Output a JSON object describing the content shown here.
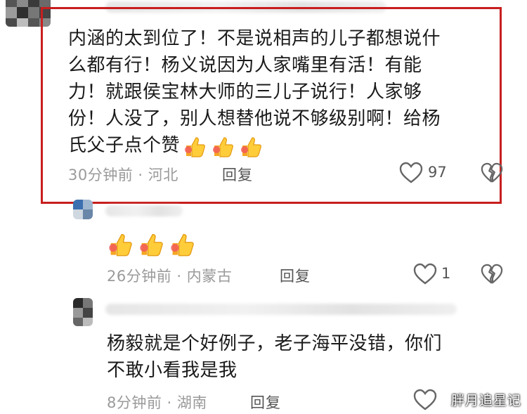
{
  "comments": [
    {
      "text_lines": [
        "内涵的太到位了！不是说相声的儿子都想说什",
        "么都有行！杨义说因为人家嘴里有活！有能",
        "力！就跟侯宝林大师的三儿子说行！人家够",
        "份！人没了，别人想替他说不够级别啊！给杨",
        "氏父子点个赞"
      ],
      "emoji": [
        "thumbs-up",
        "thumbs-up",
        "thumbs-up"
      ],
      "time_location": "30分钟前 · 河北",
      "reply_label": "回复",
      "likes": "97"
    },
    {
      "text_lines": [],
      "emoji": [
        "thumbs-up",
        "thumbs-up",
        "thumbs-up"
      ],
      "time_location": "26分钟前 · 内蒙古",
      "reply_label": "回复",
      "likes": "1"
    },
    {
      "text_lines": [
        "杨毅就是个好例子，老子海平没错，你们",
        "不敢小看我是我"
      ],
      "emoji": [],
      "time_location": "8分钟前 · 湖南",
      "reply_label": "回复",
      "likes": ""
    }
  ],
  "watermark": "胖月追星记",
  "colors": {
    "highlight_box": "#c81e1e",
    "meta": "#9a9a9a"
  }
}
